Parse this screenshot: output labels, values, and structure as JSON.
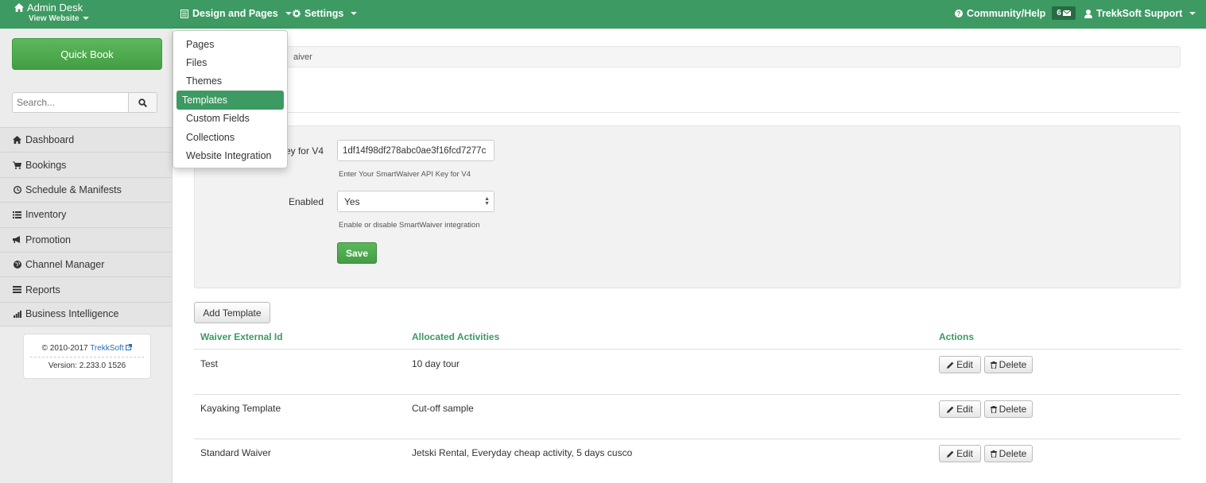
{
  "topbar": {
    "app_title": "Admin Desk",
    "view_website": "View Website",
    "design_pages": "Design and Pages",
    "settings": "Settings",
    "community": "Community/Help",
    "notifications_count": "6",
    "user": "TrekkSoft Support",
    "bg_color": "#3d9a62"
  },
  "sidebar": {
    "quick_book": "Quick Book",
    "search_placeholder": "Search...",
    "items": [
      {
        "label": "Dashboard",
        "icon": "home-icon"
      },
      {
        "label": "Bookings",
        "icon": "cart-icon"
      },
      {
        "label": "Schedule & Manifests",
        "icon": "clock-icon"
      },
      {
        "label": "Inventory",
        "icon": "list-icon"
      },
      {
        "label": "Promotion",
        "icon": "megaphone-icon"
      },
      {
        "label": "Channel Manager",
        "icon": "globe-icon"
      },
      {
        "label": "Reports",
        "icon": "reports-icon"
      },
      {
        "label": "Business Intelligence",
        "icon": "bar-chart-icon"
      }
    ],
    "footer": {
      "copyright": "© 2010-2017",
      "company": "TrekkSoft",
      "version": "Version: 2.233.0 1526"
    }
  },
  "main": {
    "breadcrumb": "aiver",
    "api_key_label": "ey for V4",
    "api_key_value": "1df14f98df278abc0ae3f16fcd7277c",
    "api_key_help": "Enter Your SmartWaiver API Key for V4",
    "enabled_label": "Enabled",
    "enabled_value": "Yes",
    "enabled_help": "Enable or disable SmartWaiver integration",
    "save": "Save",
    "add_template": "Add Template",
    "table": {
      "headers": [
        "Waiver External Id",
        "Allocated Activities",
        "Actions"
      ],
      "rows": [
        {
          "id": "Test",
          "activities": "10 day tour"
        },
        {
          "id": "Kayaking Template",
          "activities": "Cut-off sample"
        },
        {
          "id": "Standard Waiver",
          "activities": "Jetski Rental, Everyday cheap activity, 5 days cusco"
        }
      ],
      "edit": "Edit",
      "delete": "Delete"
    }
  },
  "dropdown": {
    "items": [
      "Pages",
      "Files",
      "Themes",
      "Templates",
      "Custom Fields",
      "Collections",
      "Website Integration"
    ],
    "active": "Templates"
  }
}
